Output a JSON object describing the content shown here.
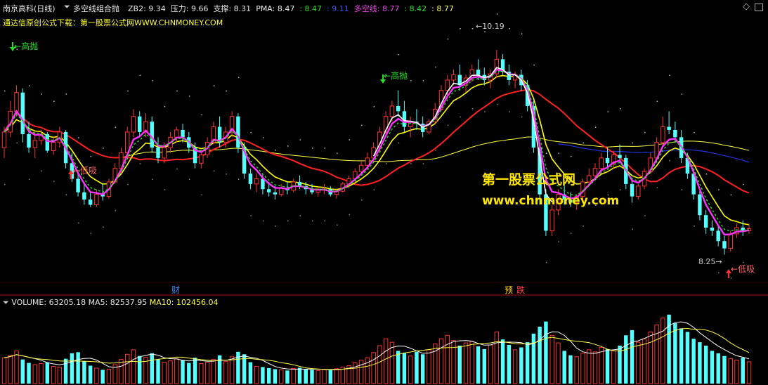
{
  "header": {
    "stock": "南京高科(日线)",
    "indicator": "多空线组合抛",
    "items": [
      {
        "label": "ZB2: 9.34",
        "color": "#e8e8e8"
      },
      {
        "label": "压力: 9.66",
        "color": "#e8e8e8"
      },
      {
        "label": "支撑: 8.31",
        "color": "#e8e8e8"
      },
      {
        "label": "PMA: 8.47",
        "color": "#e8e8e8"
      },
      {
        "label": ": 8.47",
        "color": "#22dd22"
      },
      {
        "label": ": 9.11",
        "color": "#3a54ff"
      },
      {
        "label": "多空线: 8.77",
        "color": "#ee44ee"
      },
      {
        "label": ": 8.42",
        "color": "#22dd22"
      },
      {
        "label": ": 8.77",
        "color": "#ffff66"
      }
    ],
    "subline": "通达信原创公式下载：第一股票公式网WWW.CHNMONEY.COM"
  },
  "watermark": {
    "line1": "第一股票公式网",
    "line2": "www.chnmoney.com"
  },
  "annotations": {
    "high_sell": "高抛",
    "low_buy": "低吸",
    "max_price": "10.19",
    "min_price": "8.25",
    "cai_marker": "财",
    "yu_marker": "预",
    "die_marker": "跌"
  },
  "volume_header": {
    "volume": "VOLUME: 63205.18",
    "ma5": "MA5: 82537.95",
    "ma10": "MA10: 102456.04"
  },
  "colors": {
    "up": "#ff3333",
    "down": "#54ffff",
    "yellow_ma": "#ffff44",
    "red_ma": "#ff2020",
    "magenta": "#ff33ff",
    "green": "#22dd22",
    "blue": "#2233dd",
    "white": "#ffffff"
  },
  "icons": [
    "collapse-triangle-icon",
    "diamond-nav-icon",
    "window-restore-icon"
  ],
  "chart_data": {
    "type": "candlestick",
    "max_label": 10.19,
    "min_label": 8.25,
    "y_range": [
      8.0,
      10.4
    ],
    "candles": [
      [
        9.25,
        9.45,
        9.15,
        9.4
      ],
      [
        9.4,
        9.7,
        9.35,
        9.6
      ],
      [
        9.6,
        9.85,
        9.55,
        9.78
      ],
      [
        9.78,
        9.82,
        9.3,
        9.38
      ],
      [
        9.38,
        9.5,
        9.2,
        9.25
      ],
      [
        9.25,
        9.4,
        9.15,
        9.32
      ],
      [
        9.32,
        9.42,
        9.28,
        9.38
      ],
      [
        9.38,
        9.4,
        9.2,
        9.22
      ],
      [
        9.22,
        9.35,
        9.18,
        9.3
      ],
      [
        9.3,
        9.45,
        9.25,
        9.4
      ],
      [
        9.4,
        9.42,
        9.05,
        9.1
      ],
      [
        9.1,
        9.2,
        8.92,
        8.95
      ],
      [
        8.95,
        9.0,
        8.78,
        8.82
      ],
      [
        8.82,
        8.9,
        8.7,
        8.75
      ],
      [
        8.75,
        8.82,
        8.68,
        8.7
      ],
      [
        8.7,
        8.85,
        8.68,
        8.8
      ],
      [
        8.8,
        8.9,
        8.74,
        8.78
      ],
      [
        8.78,
        8.95,
        8.76,
        8.92
      ],
      [
        8.92,
        9.1,
        8.9,
        9.05
      ],
      [
        9.05,
        9.25,
        9.0,
        9.2
      ],
      [
        9.2,
        9.45,
        9.15,
        9.4
      ],
      [
        9.4,
        9.62,
        9.35,
        9.55
      ],
      [
        9.55,
        9.6,
        9.35,
        9.4
      ],
      [
        9.4,
        9.58,
        9.35,
        9.5
      ],
      [
        9.5,
        9.55,
        9.2,
        9.25
      ],
      [
        9.25,
        9.35,
        9.1,
        9.15
      ],
      [
        9.15,
        9.3,
        9.1,
        9.25
      ],
      [
        9.25,
        9.4,
        9.2,
        9.35
      ],
      [
        9.35,
        9.45,
        9.3,
        9.42
      ],
      [
        9.42,
        9.48,
        9.3,
        9.35
      ],
      [
        9.35,
        9.4,
        9.2,
        9.25
      ],
      [
        9.25,
        9.3,
        9.05,
        9.1
      ],
      [
        9.1,
        9.22,
        9.05,
        9.18
      ],
      [
        9.18,
        9.35,
        9.15,
        9.3
      ],
      [
        9.3,
        9.5,
        9.28,
        9.45
      ],
      [
        9.45,
        9.55,
        9.25,
        9.3
      ],
      [
        9.3,
        9.45,
        9.25,
        9.4
      ],
      [
        9.4,
        9.6,
        9.35,
        9.55
      ],
      [
        9.55,
        9.58,
        9.2,
        9.25
      ],
      [
        9.25,
        9.3,
        8.95,
        9.0
      ],
      [
        9.0,
        9.05,
        8.85,
        8.9
      ],
      [
        8.9,
        9.0,
        8.82,
        8.95
      ],
      [
        8.95,
        9.0,
        8.8,
        8.85
      ],
      [
        8.85,
        8.92,
        8.78,
        8.82
      ],
      [
        8.82,
        8.88,
        8.75,
        8.8
      ],
      [
        8.8,
        8.9,
        8.78,
        8.86
      ],
      [
        8.86,
        8.92,
        8.8,
        8.84
      ],
      [
        8.84,
        8.95,
        8.82,
        8.92
      ],
      [
        8.92,
        8.98,
        8.85,
        8.88
      ],
      [
        8.88,
        8.92,
        8.8,
        8.85
      ],
      [
        8.85,
        8.9,
        8.8,
        8.82
      ],
      [
        8.82,
        8.86,
        8.78,
        8.84
      ],
      [
        8.84,
        8.9,
        8.8,
        8.85
      ],
      [
        8.85,
        8.88,
        8.78,
        8.8
      ],
      [
        8.8,
        8.85,
        8.76,
        8.83
      ],
      [
        8.83,
        8.92,
        8.82,
        8.9
      ],
      [
        8.9,
        8.98,
        8.86,
        8.95
      ],
      [
        8.95,
        9.05,
        8.92,
        9.02
      ],
      [
        9.02,
        9.12,
        9.0,
        9.08
      ],
      [
        9.08,
        9.2,
        9.05,
        9.15
      ],
      [
        9.15,
        9.3,
        9.1,
        9.25
      ],
      [
        9.25,
        9.45,
        9.2,
        9.4
      ],
      [
        9.4,
        9.6,
        9.35,
        9.55
      ],
      [
        9.55,
        9.7,
        9.5,
        9.65
      ],
      [
        9.65,
        9.8,
        9.55,
        9.6
      ],
      [
        9.6,
        9.7,
        9.4,
        9.45
      ],
      [
        9.45,
        9.55,
        9.35,
        9.5
      ],
      [
        9.5,
        9.62,
        9.42,
        9.48
      ],
      [
        9.48,
        9.55,
        9.35,
        9.4
      ],
      [
        9.4,
        9.52,
        9.38,
        9.5
      ],
      [
        9.5,
        9.68,
        9.48,
        9.62
      ],
      [
        9.62,
        9.85,
        9.6,
        9.8
      ],
      [
        9.8,
        9.95,
        9.72,
        9.9
      ],
      [
        9.9,
        10.0,
        9.85,
        9.95
      ],
      [
        9.95,
        10.05,
        9.8,
        9.85
      ],
      [
        9.85,
        9.95,
        9.78,
        9.92
      ],
      [
        9.92,
        10.05,
        9.88,
        10.0
      ],
      [
        10.0,
        10.1,
        9.9,
        9.95
      ],
      [
        9.95,
        10.02,
        9.85,
        9.9
      ],
      [
        9.9,
        10.0,
        9.82,
        9.96
      ],
      [
        9.96,
        10.19,
        9.92,
        10.1
      ],
      [
        10.1,
        10.15,
        9.95,
        9.98
      ],
      [
        9.98,
        10.05,
        9.85,
        9.9
      ],
      [
        9.9,
        9.98,
        9.82,
        9.95
      ],
      [
        9.95,
        10.0,
        9.8,
        9.85
      ],
      [
        9.85,
        9.9,
        9.6,
        9.65
      ],
      [
        9.65,
        9.7,
        9.2,
        9.25
      ],
      [
        9.25,
        9.3,
        8.7,
        8.8
      ],
      [
        8.8,
        8.85,
        8.4,
        8.45
      ],
      [
        8.45,
        8.7,
        8.4,
        8.65
      ],
      [
        8.65,
        8.85,
        8.6,
        8.8
      ],
      [
        8.8,
        8.9,
        8.7,
        8.75
      ],
      [
        8.75,
        8.82,
        8.68,
        8.72
      ],
      [
        8.72,
        8.8,
        8.65,
        8.78
      ],
      [
        8.78,
        8.95,
        8.75,
        8.92
      ],
      [
        8.92,
        9.05,
        8.88,
        8.98
      ],
      [
        8.98,
        9.1,
        8.95,
        9.05
      ],
      [
        9.05,
        9.2,
        9.0,
        9.15
      ],
      [
        9.15,
        9.25,
        9.05,
        9.1
      ],
      [
        9.1,
        9.22,
        9.05,
        9.18
      ],
      [
        9.18,
        9.28,
        9.1,
        9.15
      ],
      [
        9.15,
        9.18,
        8.85,
        8.9
      ],
      [
        8.9,
        8.95,
        8.72,
        8.78
      ],
      [
        8.78,
        8.9,
        8.75,
        8.88
      ],
      [
        8.88,
        9.05,
        8.85,
        9.02
      ],
      [
        9.02,
        9.2,
        9.0,
        9.15
      ],
      [
        9.15,
        9.35,
        9.12,
        9.3
      ],
      [
        9.3,
        9.55,
        9.25,
        9.45
      ],
      [
        9.45,
        9.6,
        9.38,
        9.42
      ],
      [
        9.42,
        9.5,
        9.3,
        9.35
      ],
      [
        9.35,
        9.42,
        9.1,
        9.15
      ],
      [
        9.15,
        9.2,
        8.95,
        9.0
      ],
      [
        9.0,
        9.05,
        8.75,
        8.8
      ],
      [
        8.8,
        8.85,
        8.55,
        8.6
      ],
      [
        8.6,
        8.65,
        8.42,
        8.48
      ],
      [
        8.48,
        8.55,
        8.4,
        8.45
      ],
      [
        8.45,
        8.5,
        8.3,
        8.35
      ],
      [
        8.35,
        8.4,
        8.22,
        8.28
      ],
      [
        8.28,
        8.45,
        8.25,
        8.42
      ],
      [
        8.42,
        8.52,
        8.38,
        8.48
      ],
      [
        8.48,
        8.55,
        8.4,
        8.45
      ],
      [
        8.45,
        8.52,
        8.42,
        8.47
      ]
    ],
    "volume_panel": {
      "type": "bar",
      "series": [
        {
          "name": "VOLUME",
          "latest": 63205.18
        },
        {
          "name": "MA5",
          "latest": 82537.95
        },
        {
          "name": "MA10",
          "latest": 102456.04
        }
      ],
      "max_value": 220000,
      "volumes": [
        75000,
        82000,
        95000,
        70000,
        60000,
        55000,
        58000,
        62000,
        50000,
        48000,
        72000,
        88000,
        91000,
        65000,
        52000,
        45000,
        40000,
        42000,
        55000,
        70000,
        85000,
        98000,
        80000,
        76000,
        88000,
        70000,
        62000,
        66000,
        72000,
        68000,
        60000,
        75000,
        58000,
        62000,
        70000,
        82000,
        64000,
        78000,
        92000,
        85000,
        62000,
        50000,
        48000,
        45000,
        42000,
        40000,
        38000,
        44000,
        46000,
        42000,
        40000,
        38000,
        41000,
        39000,
        43000,
        48000,
        52000,
        60000,
        68000,
        75000,
        90000,
        110000,
        130000,
        120000,
        95000,
        88000,
        80000,
        92000,
        85000,
        98000,
        115000,
        130000,
        140000,
        125000,
        110000,
        118000,
        122000,
        108000,
        100000,
        112000,
        150000,
        128000,
        112000,
        98000,
        105000,
        120000,
        145000,
        165000,
        180000,
        140000,
        118000,
        95000,
        82000,
        78000,
        88000,
        98000,
        92000,
        105000,
        100000,
        95000,
        110000,
        140000,
        155000,
        120000,
        130000,
        150000,
        170000,
        190000,
        200000,
        175000,
        160000,
        150000,
        130000,
        120000,
        110000,
        95000,
        88000,
        80000,
        72000,
        68000,
        75000,
        63205
      ]
    }
  }
}
